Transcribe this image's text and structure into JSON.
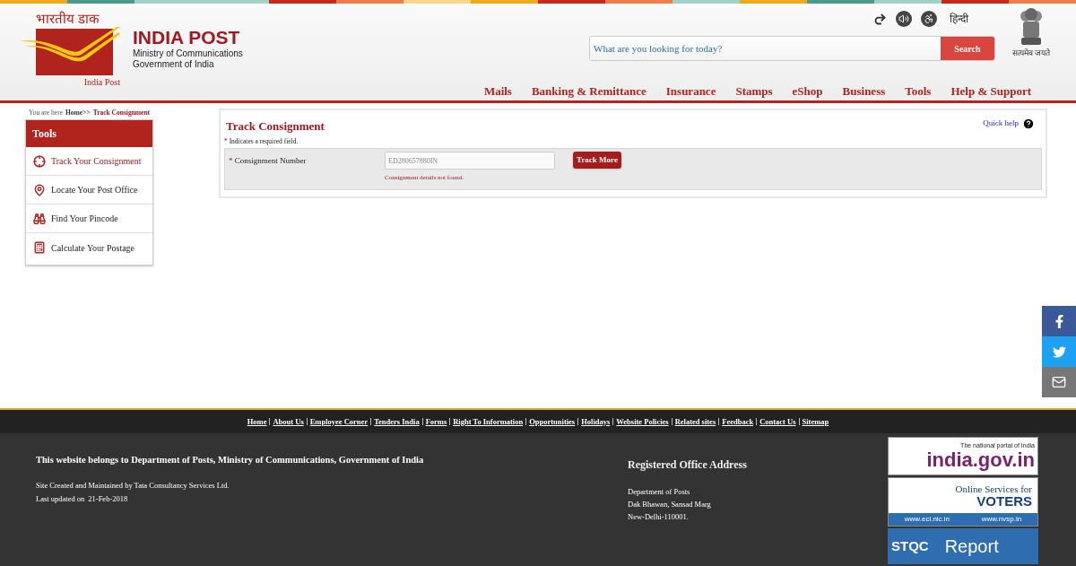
{
  "header": {
    "logo": {
      "hindi": "भारतीय डाक",
      "caption": "India Post"
    },
    "title": "INDIA POST",
    "subtitle_lines": [
      "Ministry of Communications",
      "Government of India"
    ],
    "search": {
      "placeholder": "What are you looking for today?",
      "button": "Search"
    },
    "language": "हिन्दी",
    "emblem_motto": "सत्यमेव जयते",
    "nav": [
      {
        "label": "Mails"
      },
      {
        "label": "Banking & Remittance"
      },
      {
        "label": "Insurance"
      },
      {
        "label": "Stamps"
      },
      {
        "label": "eShop"
      },
      {
        "label": "Business"
      },
      {
        "label": "Tools"
      },
      {
        "label": "Help & Support"
      }
    ]
  },
  "breadcrumb": {
    "prefix": "You are here",
    "home": "Home>>",
    "current": "Track Consignment"
  },
  "sidebar": {
    "title": "Tools",
    "items": [
      {
        "label": "Track Your Consignment",
        "kind": "crosshair",
        "selected": true
      },
      {
        "label": "Locate Your Post Office",
        "kind": "pin",
        "selected": false
      },
      {
        "label": "Find Your Pincode",
        "kind": "binoculars",
        "selected": false
      },
      {
        "label": "Calculate Your Postage",
        "kind": "calculator",
        "selected": false
      }
    ]
  },
  "form": {
    "title": "Track Consignment",
    "quick_help": "Quick help",
    "required_note": "Indicates a required field.",
    "required_mark": "*",
    "field_label": "Consignment Number",
    "field_value": "ED280657880IN",
    "button": "Track More",
    "error": "Consignment details not found."
  },
  "footer": {
    "links": [
      "Home",
      "About Us",
      "Employee Corner",
      "Tenders India",
      "Forms",
      "Right To Information",
      "Opportunities",
      "Holidays",
      "Website Policies",
      "Related sites",
      "Feedback",
      "Contact Us",
      "Sitemap"
    ],
    "ownership": "This website belongs to Department of Posts, Ministry of Communications, Government of India",
    "maintained": "Site Created and Maintained by Tata Consultancy Services Ltd.",
    "updated_label": "Last updated on",
    "updated_date": "21-Feb-2018",
    "address_title": "Registered Office Address",
    "address_lines": [
      "Department of Posts",
      "Dak Bhawan, Sansad Marg",
      "New-Delhi-110001."
    ],
    "banners": {
      "portal_tagline": "The national portal of India",
      "portal_name": "india.gov.in",
      "voters_line": "Online Services for",
      "voters_word": "VOTERS",
      "voters_sites": [
        "www.eci.nic.in",
        "www.nvsp.in"
      ],
      "stqc": "STQC",
      "report": "Report"
    }
  }
}
